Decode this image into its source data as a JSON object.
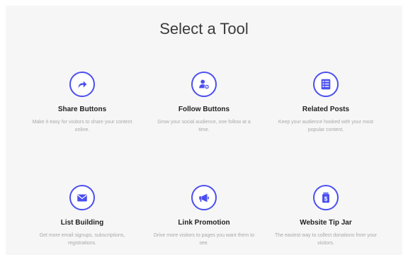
{
  "page": {
    "title": "Select a Tool"
  },
  "tools": [
    {
      "name": "Share Buttons",
      "description": "Make it easy for visitors to share your content online.",
      "icon": "share-arrow-icon"
    },
    {
      "name": "Follow Buttons",
      "description": "Grow your social audience, one follow at a time.",
      "icon": "add-user-icon"
    },
    {
      "name": "Related Posts",
      "description": "Keep your audience hooked with your most popular content.",
      "icon": "list-icon"
    },
    {
      "name": "List Building",
      "description": "Get more email signups, subscriptions, registrations.",
      "icon": "envelope-icon"
    },
    {
      "name": "Link Promotion",
      "description": "Drive more visitors to pages you want them to see.",
      "icon": "megaphone-icon"
    },
    {
      "name": "Website Tip Jar",
      "description": "The easiest way to collect donations from your visitors.",
      "icon": "dollar-jar-icon"
    }
  ],
  "colors": {
    "accent": "#4b4ff0",
    "panel": "#f6f6f6",
    "muted_text": "#a8a8a8"
  }
}
